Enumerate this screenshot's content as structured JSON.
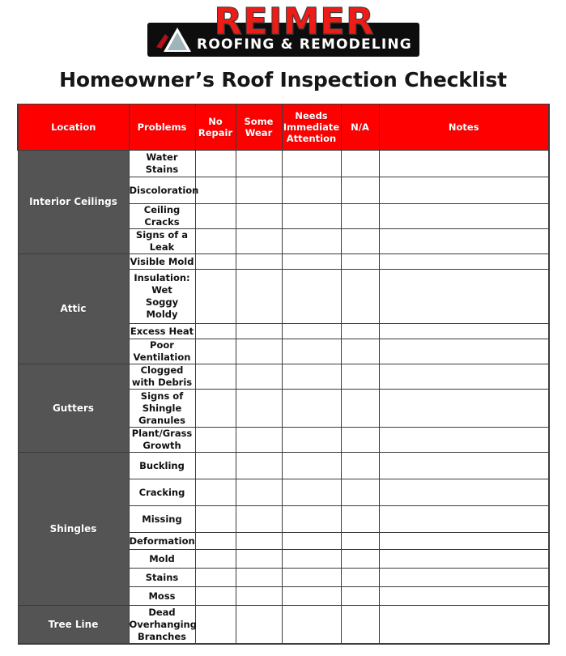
{
  "logo": {
    "wordmark": "REIMER",
    "tagline": "ROOFING & REMODELING",
    "icon": "roof-triangle-icon",
    "colors": {
      "red": "#ED1C16",
      "bar": "#0D0D0D",
      "text": "#FFFFFF"
    }
  },
  "page_title": "Homeowner’s Roof Inspection Checklist",
  "table": {
    "colors": {
      "header_bg": "#FE0000",
      "location_bg": "#545454",
      "grid": "#3C3C3C"
    },
    "headers": [
      "Location",
      "Problems",
      "No Repair",
      "Some Wear",
      "Needs Immediate Attention",
      "N/A",
      "Notes"
    ],
    "sections": [
      {
        "location": "Interior Ceilings",
        "rows": [
          {
            "problem": "Water Stains",
            "no_repair": "",
            "some_wear": "",
            "needs_immediate_attention": "",
            "na": "",
            "notes": ""
          },
          {
            "problem": "Discoloration",
            "no_repair": "",
            "some_wear": "",
            "needs_immediate_attention": "",
            "na": "",
            "notes": ""
          },
          {
            "problem": "Ceiling Cracks",
            "no_repair": "",
            "some_wear": "",
            "needs_immediate_attention": "",
            "na": "",
            "notes": ""
          },
          {
            "problem": "Signs of a Leak",
            "no_repair": "",
            "some_wear": "",
            "needs_immediate_attention": "",
            "na": "",
            "notes": ""
          }
        ]
      },
      {
        "location": "Attic",
        "rows": [
          {
            "problem": "Visible Mold",
            "no_repair": "",
            "some_wear": "",
            "needs_immediate_attention": "",
            "na": "",
            "notes": ""
          },
          {
            "problem": "Insulation:\nWet\nSoggy\nMoldy",
            "no_repair": "",
            "some_wear": "",
            "needs_immediate_attention": "",
            "na": "",
            "notes": ""
          },
          {
            "problem": "Excess Heat",
            "no_repair": "",
            "some_wear": "",
            "needs_immediate_attention": "",
            "na": "",
            "notes": ""
          },
          {
            "problem": "Poor Ventilation",
            "no_repair": "",
            "some_wear": "",
            "needs_immediate_attention": "",
            "na": "",
            "notes": ""
          }
        ]
      },
      {
        "location": "Gutters",
        "rows": [
          {
            "problem": "Clogged with Debris",
            "no_repair": "",
            "some_wear": "",
            "needs_immediate_attention": "",
            "na": "",
            "notes": ""
          },
          {
            "problem": "Signs of Shingle Granules",
            "no_repair": "",
            "some_wear": "",
            "needs_immediate_attention": "",
            "na": "",
            "notes": ""
          },
          {
            "problem": "Plant/Grass Growth",
            "no_repair": "",
            "some_wear": "",
            "needs_immediate_attention": "",
            "na": "",
            "notes": ""
          }
        ]
      },
      {
        "location": "Shingles",
        "rows": [
          {
            "problem": "Buckling",
            "no_repair": "",
            "some_wear": "",
            "needs_immediate_attention": "",
            "na": "",
            "notes": ""
          },
          {
            "problem": "Cracking",
            "no_repair": "",
            "some_wear": "",
            "needs_immediate_attention": "",
            "na": "",
            "notes": ""
          },
          {
            "problem": "Missing",
            "no_repair": "",
            "some_wear": "",
            "needs_immediate_attention": "",
            "na": "",
            "notes": ""
          },
          {
            "problem": "Deformation",
            "no_repair": "",
            "some_wear": "",
            "needs_immediate_attention": "",
            "na": "",
            "notes": ""
          },
          {
            "problem": "Mold",
            "no_repair": "",
            "some_wear": "",
            "needs_immediate_attention": "",
            "na": "",
            "notes": ""
          },
          {
            "problem": "Stains",
            "no_repair": "",
            "some_wear": "",
            "needs_immediate_attention": "",
            "na": "",
            "notes": ""
          },
          {
            "problem": "Moss",
            "no_repair": "",
            "some_wear": "",
            "needs_immediate_attention": "",
            "na": "",
            "notes": ""
          }
        ]
      },
      {
        "location": "Tree Line",
        "rows": [
          {
            "problem": "Dead Overhanging Branches",
            "no_repair": "",
            "some_wear": "",
            "needs_immediate_attention": "",
            "na": "",
            "notes": ""
          }
        ]
      }
    ]
  }
}
